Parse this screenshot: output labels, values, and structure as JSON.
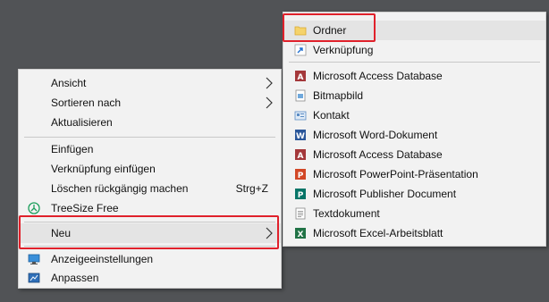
{
  "context_menu": {
    "items": [
      {
        "label": "Ansicht",
        "submenu": true
      },
      {
        "label": "Sortieren nach",
        "submenu": true
      },
      {
        "label": "Aktualisieren"
      },
      {
        "label": "Einfügen"
      },
      {
        "label": "Verknüpfung einfügen"
      },
      {
        "label": "Löschen rückgängig machen",
        "shortcut": "Strg+Z"
      },
      {
        "label": "TreeSize Free",
        "icon": "treesize-icon"
      },
      {
        "label": "Neu",
        "submenu": true,
        "highlighted": true
      },
      {
        "label": "Anzeigeeinstellungen",
        "icon": "display-icon"
      },
      {
        "label": "Anpassen",
        "icon": "personalize-icon"
      }
    ]
  },
  "new_submenu": {
    "items": [
      {
        "label": "Ordner",
        "icon": "folder-icon",
        "highlighted": true
      },
      {
        "label": "Verknüpfung",
        "icon": "shortcut-icon"
      },
      {
        "label": "Microsoft Access Database",
        "icon": "access-icon"
      },
      {
        "label": "Bitmapbild",
        "icon": "bitmap-icon"
      },
      {
        "label": "Kontakt",
        "icon": "contact-icon"
      },
      {
        "label": "Microsoft Word-Dokument",
        "icon": "word-icon"
      },
      {
        "label": "Microsoft Access Database",
        "icon": "access-icon"
      },
      {
        "label": "Microsoft PowerPoint-Präsentation",
        "icon": "powerpoint-icon"
      },
      {
        "label": "Microsoft Publisher Document",
        "icon": "publisher-icon"
      },
      {
        "label": "Textdokument",
        "icon": "text-document-icon"
      },
      {
        "label": "Microsoft Excel-Arbeitsblatt",
        "icon": "excel-icon"
      }
    ]
  },
  "colors": {
    "desktop": "#515356",
    "menu_bg": "#f2f2f2",
    "highlight": "#e4e4e4",
    "annotation_red": "#e0212b"
  }
}
